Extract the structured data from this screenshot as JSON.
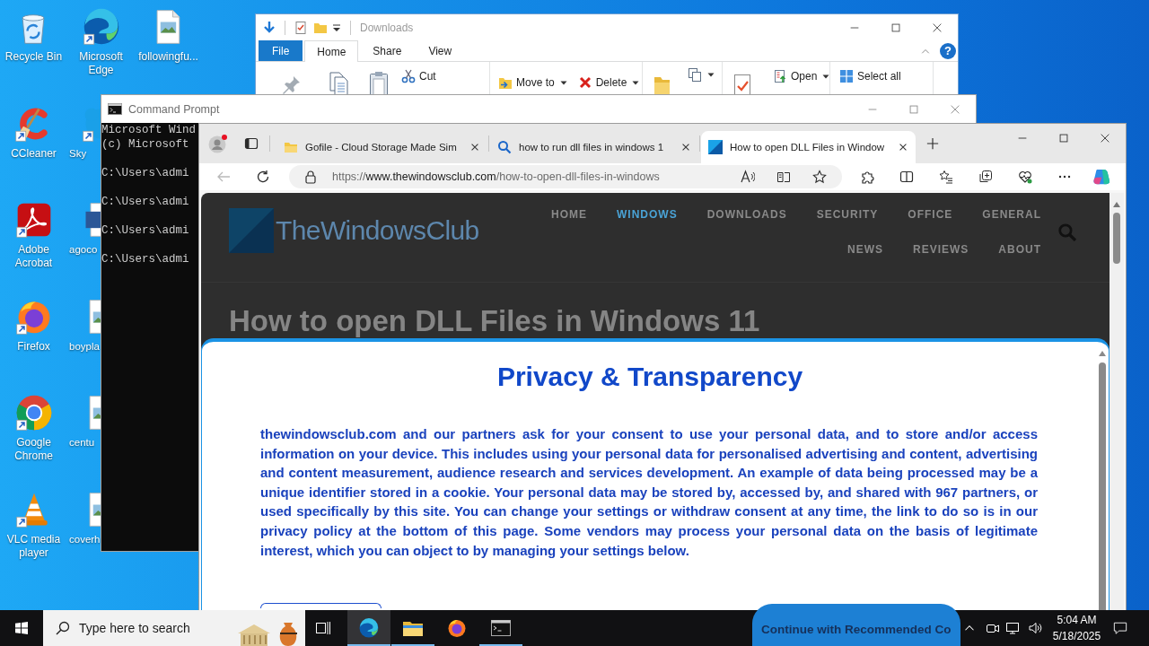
{
  "desktop": {
    "icons": [
      {
        "label": "Recycle Bin",
        "kind": "recycle-bin",
        "shortcut": false,
        "covered": false
      },
      {
        "label": "CCleaner",
        "kind": "ccleaner",
        "shortcut": true,
        "covered": false
      },
      {
        "label": "Adobe Acrobat",
        "kind": "acrobat",
        "shortcut": true,
        "covered": false
      },
      {
        "label": "Firefox",
        "kind": "firefox",
        "shortcut": true,
        "covered": false
      },
      {
        "label": "Google Chrome",
        "kind": "chrome",
        "shortcut": true,
        "covered": false
      },
      {
        "label": "VLC media player",
        "kind": "vlc",
        "shortcut": true,
        "covered": false
      },
      {
        "label": "Microsoft Edge",
        "kind": "edge",
        "shortcut": true,
        "covered": false
      },
      {
        "label": "Sky",
        "kind": "skype",
        "shortcut": true,
        "covered": true
      },
      {
        "label": "agoco",
        "kind": "word-file",
        "shortcut": false,
        "covered": true
      },
      {
        "label": "boypla",
        "kind": "image-file",
        "shortcut": false,
        "covered": true
      },
      {
        "label": "centu",
        "kind": "image-file",
        "shortcut": false,
        "covered": true
      },
      {
        "label": "coverh",
        "kind": "image-file",
        "shortcut": false,
        "covered": true
      },
      {
        "label": "followingfu...",
        "kind": "image-file",
        "shortcut": false,
        "covered": false
      }
    ]
  },
  "explorer": {
    "title": "Downloads",
    "help": "?",
    "tabs": [
      {
        "label": "File",
        "kind": "file",
        "selected": false
      },
      {
        "label": "Home",
        "kind": "tab",
        "selected": true
      },
      {
        "label": "Share",
        "kind": "tab",
        "selected": false
      },
      {
        "label": "View",
        "kind": "tab",
        "selected": false
      }
    ],
    "ribbon": [
      {
        "commands": [
          {
            "kind": "pin",
            "dropdown": false
          },
          {
            "kind": "copy",
            "dropdown": false
          },
          {
            "kind": "paste",
            "dropdown": false
          },
          {
            "kind": "cut",
            "label": "Cut",
            "dropdown": false
          }
        ]
      },
      {
        "commands": [
          {
            "kind": "move-to",
            "label": "Move to",
            "dropdown": true
          },
          {
            "kind": "delete",
            "label": "Delete",
            "dropdown": true
          }
        ]
      },
      {
        "commands": [
          {
            "kind": "new-folder",
            "dropdown": false
          },
          {
            "kind": "copy-to",
            "dropdown": true
          }
        ]
      },
      {
        "commands": [
          {
            "kind": "properties",
            "dropdown": false
          },
          {
            "kind": "open",
            "label": "Open",
            "dropdown": true
          }
        ]
      },
      {
        "commands": [
          {
            "kind": "select-all",
            "label": "Select all",
            "dropdown": false
          }
        ]
      }
    ]
  },
  "cmd": {
    "title": "Command Prompt",
    "lines": [
      {
        "kind": "output",
        "text": "Microsoft Wind"
      },
      {
        "kind": "output",
        "text": "(c) Microsoft"
      },
      {
        "kind": "prompt",
        "text": "C:\\Users\\admi"
      },
      {
        "kind": "prompt",
        "text": "C:\\Users\\admi"
      },
      {
        "kind": "prompt",
        "text": "C:\\Users\\admi"
      },
      {
        "kind": "prompt",
        "text": "C:\\Users\\admi"
      }
    ]
  },
  "browser": {
    "tabs": [
      {
        "title": "Gofile - Cloud Storage Made Sim",
        "kind": "folder",
        "selected": false
      },
      {
        "title": "how to run dll files in windows 1",
        "kind": "search",
        "selected": false
      },
      {
        "title": "How to open DLL Files in Window",
        "kind": "site",
        "selected": true
      }
    ],
    "back": {
      "disabled": true
    },
    "address": {
      "scheme": "https://",
      "host": "www.thewindowsclub.com",
      "path": "/how-to-open-dll-files-in-windows"
    },
    "site": {
      "logo": "TheWindowsClub",
      "nav": [
        {
          "label": "HOME",
          "selected": false
        },
        {
          "label": "WINDOWS",
          "selected": true
        },
        {
          "label": "DOWNLOADS",
          "selected": false
        },
        {
          "label": "SECURITY",
          "selected": false
        },
        {
          "label": "OFFICE",
          "selected": false
        },
        {
          "label": "GENERAL",
          "selected": false
        },
        {
          "label": "NEWS",
          "selected": false
        },
        {
          "label": "REVIEWS",
          "selected": false
        },
        {
          "label": "ABOUT",
          "selected": false
        }
      ],
      "headline": "How to open DLL Files in Windows 11"
    },
    "dialog": {
      "title": "Privacy & Transparency",
      "body": "thewindowsclub.com and our partners ask for your consent to use your personal data, and to store and/or access information on your device. This includes using your personal data for personalised advertising and content, advertising and content measurement, audience research and services development. An example of data being processed may be a unique identifier stored in a cookie. Your personal data may be stored by, accessed by, and shared with 967 partners, or used specifically by this site. You can change your settings or withdraw consent at any time, the link to do so is in our privacy policy at the bottom of this page. Some vendors may process your personal data on the basis of legitimate interest, which you can object to by managing your settings below.",
      "buttons": [
        {
          "kind": "outline"
        },
        {
          "kind": "primary",
          "label": "Continue with Recommended Co"
        }
      ]
    }
  },
  "taskbar": {
    "search": {
      "placeholder": "Type here to search"
    },
    "apps": [
      {
        "kind": "edge",
        "running": true,
        "active": true
      },
      {
        "kind": "explorer",
        "running": true,
        "active": false
      },
      {
        "kind": "firefox",
        "running": false,
        "active": false
      },
      {
        "kind": "terminal",
        "running": true,
        "active": false
      }
    ],
    "clock": {
      "time": "5:04 AM",
      "date": "5/18/2025"
    }
  }
}
